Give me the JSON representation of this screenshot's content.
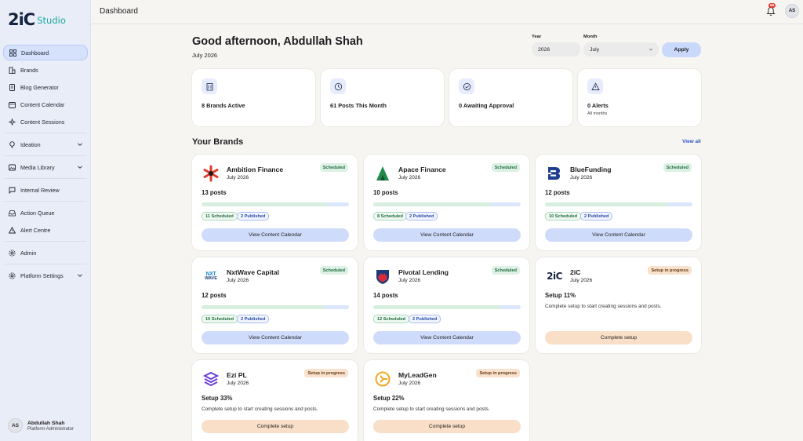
{
  "sidebar": {
    "logo_mark": "2iC",
    "logo_text": "Studio",
    "items": [
      {
        "label": "Dashboard",
        "icon": "grid-icon"
      },
      {
        "label": "Brands",
        "icon": "buildings-icon"
      },
      {
        "label": "Blog Generator",
        "icon": "document-icon"
      },
      {
        "label": "Content Calendar",
        "icon": "calendar-icon"
      },
      {
        "label": "Content Sessions",
        "icon": "sparkle-icon"
      },
      {
        "label": "Ideation",
        "icon": "lightbulb-icon"
      },
      {
        "label": "Media Library",
        "icon": "image-icon"
      },
      {
        "label": "Internal Review",
        "icon": "chat-icon"
      },
      {
        "label": "Action Queue",
        "icon": "inbox-icon"
      },
      {
        "label": "Alert Centre",
        "icon": "warning-icon"
      },
      {
        "label": "Admin",
        "icon": "gear-icon"
      },
      {
        "label": "Platform Settings",
        "icon": "gear-icon"
      }
    ],
    "user": {
      "initials": "AS",
      "name": "Abdullah Shah",
      "role": "Platform Administrator"
    }
  },
  "topbar": {
    "title": "Dashboard",
    "notification_count": "86",
    "avatar_initials": "AS"
  },
  "header": {
    "greeting": "Good afternoon, Abdullah Shah",
    "period": "July 2026"
  },
  "filters": {
    "year_label": "Year",
    "year_value": "2026",
    "month_label": "Month",
    "month_value": "July",
    "apply_label": "Apply"
  },
  "stats": [
    {
      "label": "8 Brands Active",
      "sub": "",
      "icon": "building-icon"
    },
    {
      "label": "61 Posts This Month",
      "sub": "",
      "icon": "clock-icon"
    },
    {
      "label": "0 Awaiting Approval",
      "sub": "",
      "icon": "check-circle-icon"
    },
    {
      "label": "0 Alerts",
      "sub": "All months",
      "icon": "warning-icon"
    }
  ],
  "brands_section": {
    "title": "Your Brands",
    "view_all": "View all"
  },
  "brands": [
    {
      "name": "Ambition Finance",
      "date": "July 2026",
      "status": "Scheduled",
      "posts": "13 posts",
      "scheduled": "11 Scheduled",
      "published": "2 Published",
      "progress": 0.85,
      "button": "View Content Calendar"
    },
    {
      "name": "Apace Finance",
      "date": "July 2026",
      "status": "Scheduled",
      "posts": "10 posts",
      "scheduled": "8 Scheduled",
      "published": "2 Published",
      "progress": 0.8,
      "button": "View Content Calendar"
    },
    {
      "name": "BlueFunding",
      "date": "July 2026",
      "status": "Scheduled",
      "posts": "12 posts",
      "scheduled": "10 Scheduled",
      "published": "2 Published",
      "progress": 0.83,
      "button": "View Content Calendar"
    },
    {
      "name": "NxtWave Capital",
      "date": "July 2026",
      "status": "Scheduled",
      "posts": "12 posts",
      "scheduled": "10 Scheduled",
      "published": "2 Published",
      "progress": 0.83,
      "button": "View Content Calendar"
    },
    {
      "name": "Pivotal Lending",
      "date": "July 2026",
      "status": "Scheduled",
      "posts": "14 posts",
      "scheduled": "12 Scheduled",
      "published": "2 Published",
      "progress": 0.86,
      "button": "View Content Calendar"
    },
    {
      "name": "2iC",
      "date": "July 2026",
      "status": "Setup in progress",
      "setup": "Setup 11%",
      "setup_text": "Complete setup to start creating sessions and posts.",
      "button": "Complete setup"
    },
    {
      "name": "Ezi PL",
      "date": "July 2026",
      "status": "Setup in progress",
      "setup": "Setup 33%",
      "setup_text": "Complete setup to start creating sessions and posts.",
      "button": "Complete setup"
    },
    {
      "name": "MyLeadGen",
      "date": "July 2026",
      "status": "Setup in progress",
      "setup": "Setup 22%",
      "setup_text": "Complete setup to start creating sessions and posts.",
      "button": "Complete setup"
    }
  ],
  "brand_logos": {
    "nxtwave_line1": "NXT",
    "nxtwave_line2": "WAVE",
    "twoic": "2iC"
  },
  "colors": {
    "accent": "#2a55c8",
    "sidebar_bg": "#e9edf8",
    "scheduled_pill": "#dcf1e4",
    "setup_pill": "#f8e1cd"
  }
}
